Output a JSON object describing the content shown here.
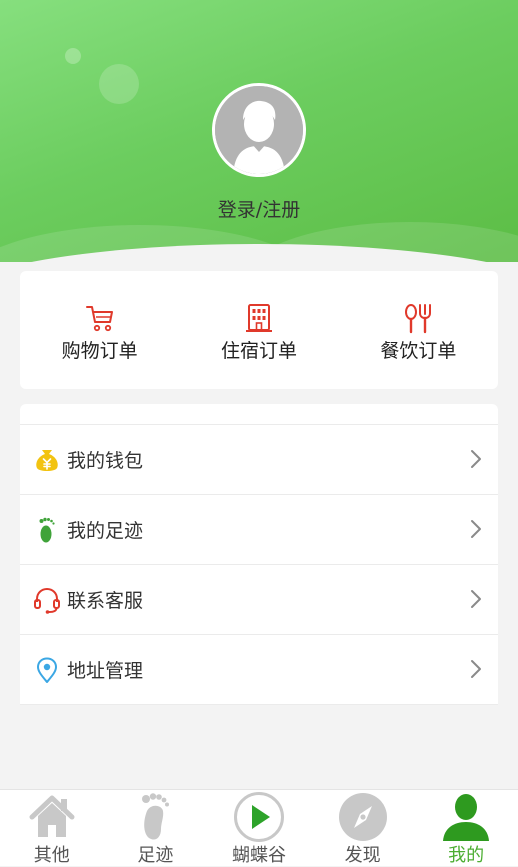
{
  "header": {
    "login_label": "登录/注册"
  },
  "orders": [
    {
      "label": "购物订单",
      "icon": "shopping-cart-icon"
    },
    {
      "label": "住宿订单",
      "icon": "hotel-building-icon"
    },
    {
      "label": "餐饮订单",
      "icon": "dining-utensils-icon"
    }
  ],
  "menu": [
    {
      "label": "我的钱包",
      "icon": "wallet-icon"
    },
    {
      "label": "我的足迹",
      "icon": "footprint-icon"
    },
    {
      "label": "联系客服",
      "icon": "headset-icon"
    },
    {
      "label": "地址管理",
      "icon": "location-pin-icon"
    }
  ],
  "tabbar": {
    "active": "我的",
    "tabs": [
      {
        "label": "其他",
        "icon": "home-icon"
      },
      {
        "label": "足迹",
        "icon": "footprint-icon"
      },
      {
        "label": "蝴蝶谷",
        "icon": "play-icon"
      },
      {
        "label": "发现",
        "icon": "compass-icon"
      },
      {
        "label": "我的",
        "icon": "person-icon"
      }
    ]
  },
  "colors": {
    "header_green": "#6ccd5f",
    "accent_red": "#e0392b",
    "active_green": "#3a9b1f",
    "inactive_gray": "#c8c8c8"
  }
}
